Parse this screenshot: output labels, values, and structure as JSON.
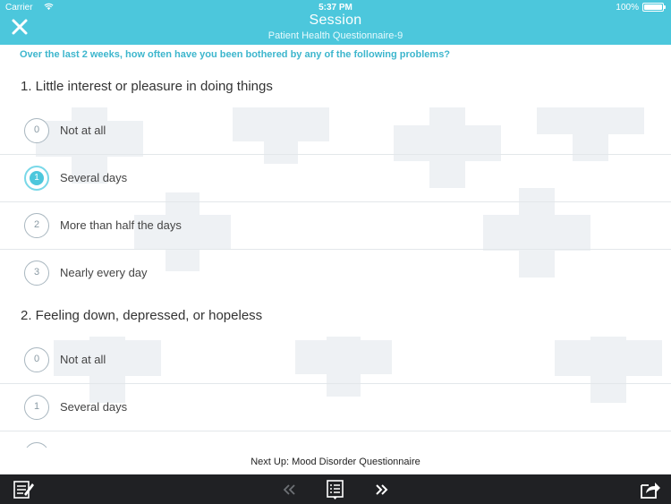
{
  "status_bar": {
    "carrier": "Carrier",
    "time": "5:37 PM",
    "battery": "100%"
  },
  "header": {
    "title": "Session",
    "subtitle": "Patient Health Questionnaire-9",
    "close_icon": "close-icon"
  },
  "instruction": "Over the last 2 weeks, how often have you been bothered by any of the following problems?",
  "questions": [
    {
      "text": "1. Little interest or pleasure in doing things",
      "selected": "1",
      "options": [
        {
          "value": "0",
          "label": "Not at all"
        },
        {
          "value": "1",
          "label": "Several days"
        },
        {
          "value": "2",
          "label": "More than half the days"
        },
        {
          "value": "3",
          "label": "Nearly every day"
        }
      ]
    },
    {
      "text": "2. Feeling down, depressed, or hopeless",
      "options": [
        {
          "value": "0",
          "label": "Not at all"
        },
        {
          "value": "1",
          "label": "Several days"
        }
      ]
    }
  ],
  "next_up": "Next Up: Mood Disorder Questionnaire",
  "toolbar": {
    "left_icon": "notes-icon",
    "prev_icon": "double-chevron-left-icon",
    "list_icon": "question-list-icon",
    "next_icon": "double-chevron-right-icon",
    "share_icon": "share-icon"
  },
  "colors": {
    "accent": "#4cc7dc",
    "toolbar": "#202124"
  }
}
